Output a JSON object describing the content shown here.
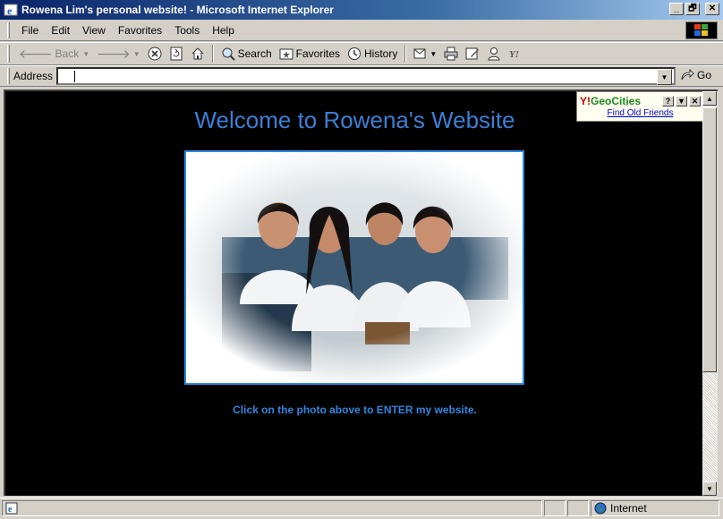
{
  "window": {
    "title": "Rowena Lim's personal website! - Microsoft Internet Explorer",
    "minimize_label": "_",
    "maximize_label": "🗗",
    "close_label": "✕"
  },
  "menu": {
    "items": [
      "File",
      "Edit",
      "View",
      "Favorites",
      "Tools",
      "Help"
    ]
  },
  "toolbar": {
    "back_label": "Back",
    "search_label": "Search",
    "favorites_label": "Favorites",
    "history_label": "History"
  },
  "address": {
    "label": "Address",
    "value": "",
    "go_label": "Go"
  },
  "page": {
    "heading": "Welcome to Rowena's Website",
    "enter_text": "Click on the photo above to ENTER my website.",
    "background": "#000000",
    "heading_color": "#3b7fd6"
  },
  "geocities": {
    "logo_y": "Y!",
    "logo_text": "GeoCities",
    "help_label": "?",
    "close_label": "✕",
    "link_text": "Find Old Friends"
  },
  "status": {
    "zone": "Internet"
  }
}
